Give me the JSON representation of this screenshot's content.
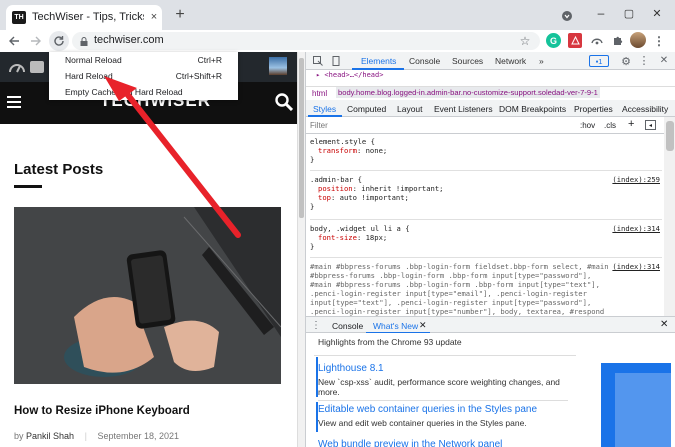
{
  "browser": {
    "tab_title": "TechWiser - Tips, Tricks & How to",
    "favicon_text": "TH",
    "tab_close": "×",
    "new_tab": "+",
    "url": "techwiser.com",
    "window_controls": {
      "minimize": "–",
      "maximize": "▢",
      "close": "✕"
    }
  },
  "context_menu": {
    "items": [
      {
        "label": "Normal Reload",
        "shortcut": "Ctrl+R"
      },
      {
        "label": "Hard Reload",
        "shortcut": "Ctrl+Shift+R"
      },
      {
        "label": "Empty Cache and Hard Reload",
        "shortcut": ""
      }
    ]
  },
  "page": {
    "logo": "TECHWISER",
    "section_title": "Latest Posts",
    "post_title": "How to Resize iPhone Keyboard",
    "post_author_prefix": "by",
    "post_author": "Pankil Shah",
    "post_date": "September 18, 2021"
  },
  "devtools": {
    "top_tabs": [
      "Elements",
      "Console",
      "Sources",
      "Network",
      "»"
    ],
    "badge": "1",
    "dom_line": "▸ <head>…</head>",
    "crumbs": [
      "html",
      "body.home.blog.logged-in.admin-bar.no-customize-support.soledad-ver-7-9-1"
    ],
    "sub_tabs": [
      "Styles",
      "Computed",
      "Layout",
      "Event Listeners",
      "DOM Breakpoints",
      "Properties",
      "Accessibility"
    ],
    "filter_placeholder": "Filter",
    "filter_tools": [
      ":hov",
      ".cls",
      "+"
    ],
    "rules": [
      {
        "selector": "element.style {",
        "source": "",
        "props": [
          [
            "transform",
            "none;"
          ]
        ]
      },
      {
        "selector": ".admin-bar {",
        "source": "(index):259",
        "props": [
          [
            "position",
            "inherit !important;"
          ],
          [
            "top",
            "auto !important;"
          ]
        ]
      },
      {
        "selector": "body, .widget ul li a {",
        "source": "(index):314",
        "props": [
          [
            "font-size",
            "18px;"
          ]
        ]
      }
    ],
    "long_rule": "#main #bbpress-forums .bbp-login-form fieldset.bbp-form select, #main #bbpress-forums .bbp-login-form .bbp-form input[type=\"password\"], #main #bbpress-forums .bbp-login-form .bbp-form input[type=\"text\"], .penci-login-register input[type=\"email\"], .penci-login-register input[type=\"text\"], .penci-login-register input[type=\"password\"], .penci-login-register input[type=\"number\"], body, textarea, #respond textarea, .widget input[type=\"text\"], .widget input[type=\"email\"], .widget input[type=\"date\"],",
    "long_rule_source": "(index):314",
    "drawer_tabs": [
      "Console",
      "What's New"
    ],
    "highlights": "Highlights from the Chrome 93 update",
    "whats_new": [
      {
        "title": "Lighthouse 8.1",
        "desc": "New `csp-xss` audit, performance score weighting changes, and more."
      },
      {
        "title": "Editable web container queries in the Styles pane",
        "desc": "View and edit web container queries in the Styles pane."
      },
      {
        "title": "Web bundle preview in the Network panel",
        "desc": ""
      }
    ]
  },
  "colors": {
    "accent": "#1a73e8",
    "arrow": "#e8222a"
  }
}
